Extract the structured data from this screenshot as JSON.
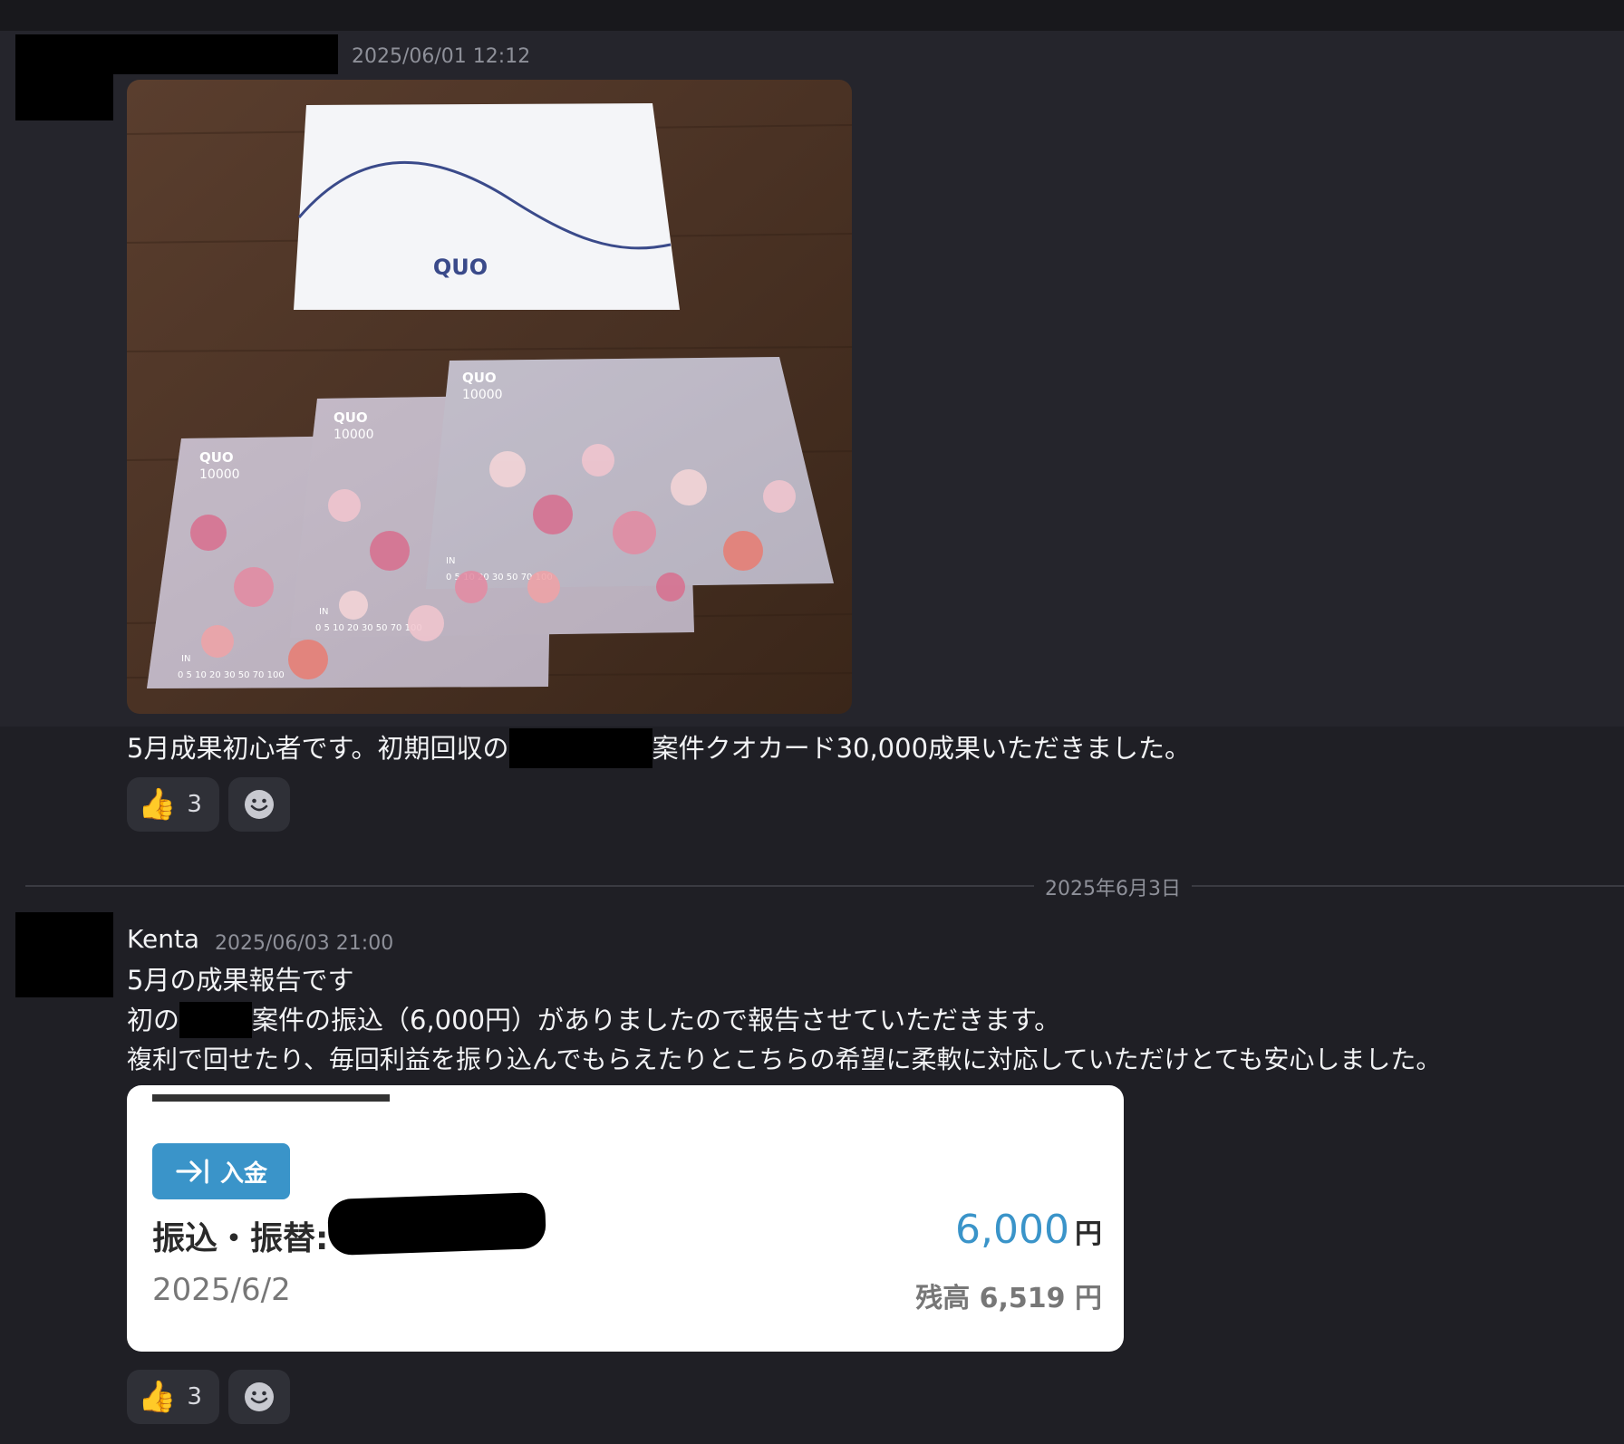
{
  "message1": {
    "timestamp": "2025/06/01 12:12",
    "text_part1": "5月成果初心者です。初期回収の",
    "text_part2": "案件クオカード30,000成果いただきました。",
    "reaction": {
      "emoji": "👍",
      "count": "3"
    },
    "image": {
      "brand": "QUO",
      "card_value": "10000",
      "card_scale": "0 5 10 20 30 50 70 100",
      "card_in": "IN"
    }
  },
  "date_divider": "2025年6月3日",
  "message2": {
    "username": "Kenta",
    "timestamp": "2025/06/03 21:00",
    "line1": "5月の成果報告です",
    "line2_part1": "初の",
    "line2_part2": "案件の振込（6,000円）がありましたので報告させていただきます。",
    "line3": "複利で回せたり、毎回利益を振り込んでもらえたりとこちらの希望に柔軟に対応していただけとても安心しました。",
    "reaction": {
      "emoji": "👍",
      "count": "3"
    },
    "bank": {
      "badge_label": "入金",
      "title": "振込・振替:",
      "amount": "6,000",
      "currency": "円",
      "date": "2025/6/2",
      "balance": "残高 6,519 円",
      "accent_color": "#3a94c9"
    }
  }
}
